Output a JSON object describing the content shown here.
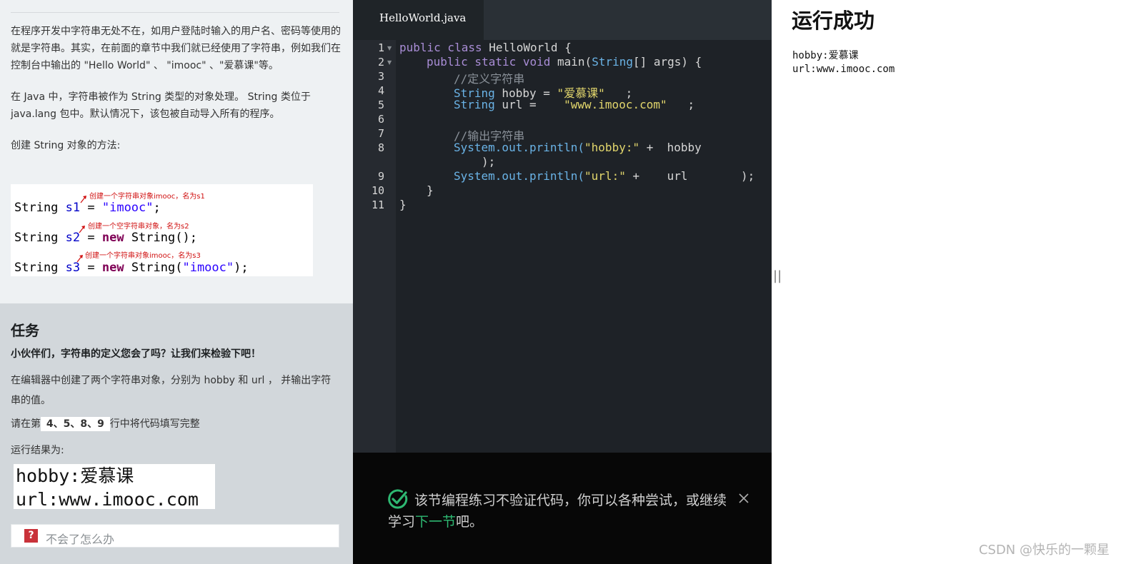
{
  "lesson": {
    "intro_p1": "在程序开发中字符串无处不在，如用户登陆时输入的用户名、密码等使用的就是字符串。其实，在前面的章节中我们就已经使用了字符串，例如我们在控制台中输出的 \"Hello World\" 、 \"imooc\" 、\"爱慕课\"等。",
    "intro_p2": "在 Java 中，字符串被作为 String 类型的对象处理。 String 类位于 java.lang 包中。默认情况下，该包被自动导入所有的程序。",
    "intro_p3": "创建 String 对象的方法:",
    "code_example": {
      "line1_prefix": "String ",
      "line1_var": "s1",
      "line1_mid": " = ",
      "line1_str": "\"imooc\"",
      "line1_end": ";",
      "note1": "创建一个字符串对象imooc，名为s1",
      "line2_prefix": "String ",
      "line2_var": "s2",
      "line2_mid": " = ",
      "line2_kw": "new",
      "line2_end": " String();",
      "note2": "创建一个空字符串对象，名为s2",
      "line3_prefix": "String ",
      "line3_var": "s3",
      "line3_mid": " = ",
      "line3_kw": "new",
      "line3_call": " String(",
      "line3_str": "\"imooc\"",
      "line3_end": ");",
      "note3": "创建一个字符串对象imooc，名为s3"
    }
  },
  "task": {
    "heading": "任务",
    "subtitle": "小伙伴们，字符串的定义您会了吗？让我们来检验下吧！",
    "desc": "在编辑器中创建了两个字符串对象，分别为 hobby 和 url ， 并输出字符串的值。",
    "instruction_prefix": "请在第",
    "instruction_lines": " 4、5、8、9 ",
    "instruction_suffix": "行中将代码填写完整",
    "result_label": "运行结果为:",
    "result_line1": "hobby:爱慕课",
    "result_line2": "url:www.imooc.com",
    "help_icon": "?",
    "help_text": "不会了怎么办"
  },
  "editor": {
    "tab_name": "HelloWorld.java",
    "line_numbers": [
      "1",
      "2",
      "3",
      "4",
      "5",
      "6",
      "7",
      "8",
      "",
      "9",
      "10",
      "11"
    ],
    "code": {
      "l1_kw": "public class",
      "l1_rest": " HelloWorld {",
      "l2_kw": "public static void",
      "l2_name": " main(",
      "l2_type": "String",
      "l2_rest": "[] args) {",
      "l3": "//定义字符串",
      "l4_type": "String",
      "l4_name": " hobby = ",
      "l4_str": "\"爱慕课\"",
      "l4_end": "   ;",
      "l5_type": "String",
      "l5_name": " url =    ",
      "l5_str": "\"www.imooc.com\"",
      "l5_end": "   ;",
      "l7": "//输出字符串",
      "l8_call": "System.out.println(",
      "l8_str": "\"hobby:\"",
      "l8_rest": " +  hobby",
      "l8_wrap": ");",
      "l9_call": "System.out.println(",
      "l9_str": "\"url:\"",
      "l9_rest": " +    url",
      "l9_end": ");",
      "l10": "}",
      "l11": "}"
    }
  },
  "notice": {
    "message_before": "该节编程练习不验证代码，你可以各种尝试，或继续学习",
    "link": "下一节",
    "message_after": "吧。"
  },
  "output": {
    "title": "运行成功",
    "line1": "hobby:爱慕课",
    "line2": "url:www.imooc.com",
    "handle": "||",
    "watermark": "CSDN @快乐的一颗星"
  },
  "colors": {
    "left_bg": "#eef1f3",
    "task_bg": "#d2d7db",
    "editor_bg": "#1e2227",
    "notice_bg": "#070707",
    "link_green": "#2eb872",
    "help_icon_red": "#c9323a"
  }
}
